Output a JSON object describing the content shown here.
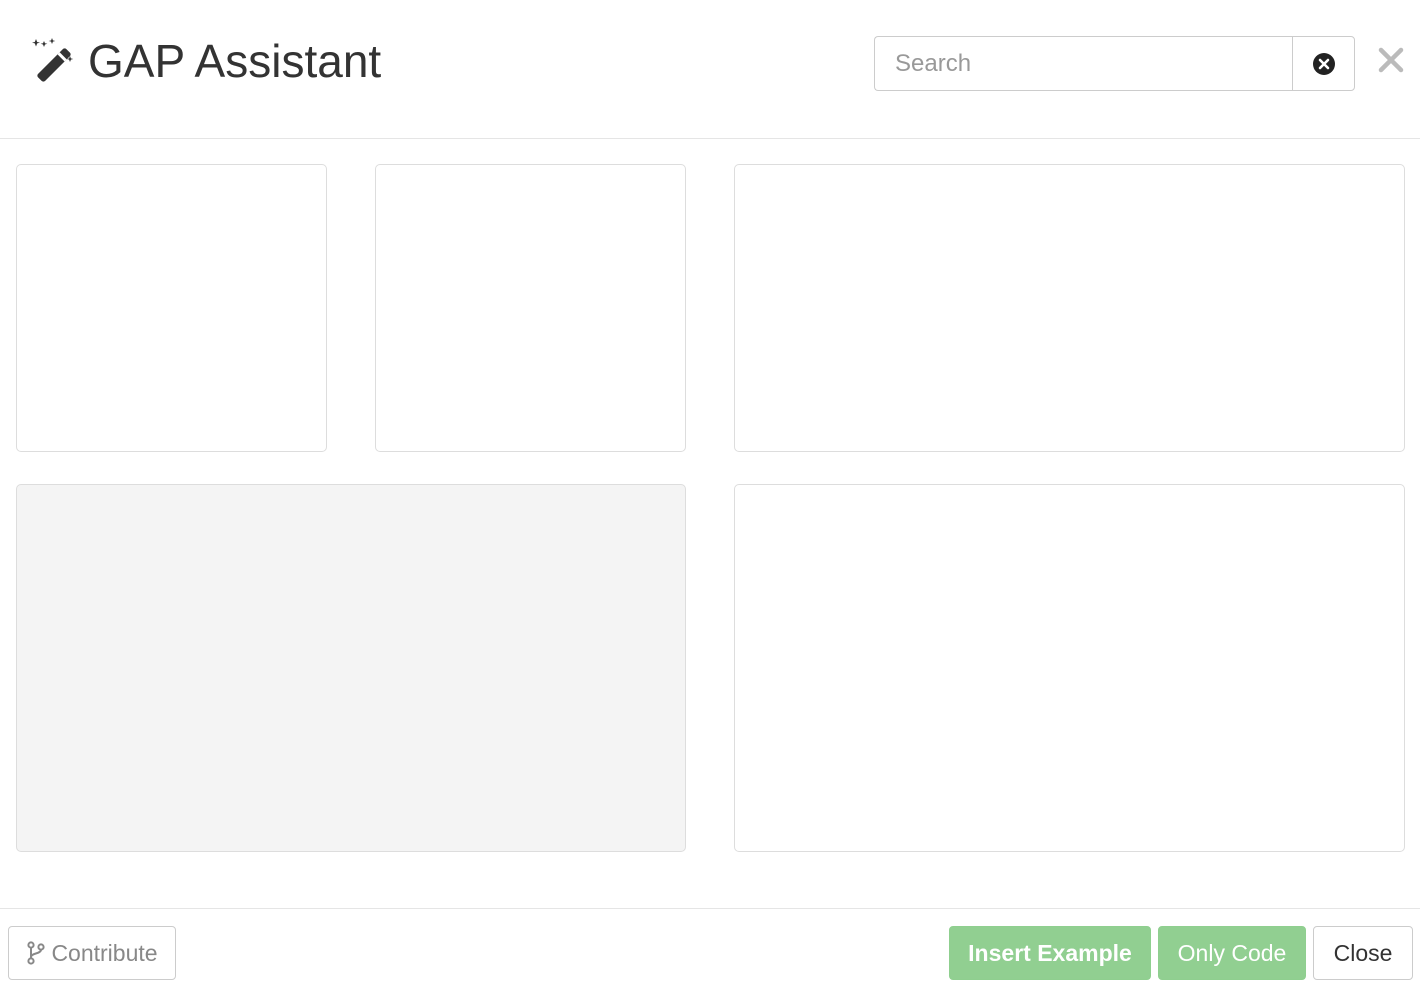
{
  "header": {
    "title": "GAP Assistant",
    "title_icon": "magic-wand-icon",
    "search": {
      "placeholder": "Search",
      "value": "",
      "clear_icon": "times-circle-icon"
    },
    "close_icon": "close-x-icon"
  },
  "footer": {
    "contribute_label": "Contribute",
    "contribute_icon": "code-fork-icon",
    "insert_example_label": "Insert Example",
    "only_code_label": "Only Code",
    "close_label": "Close"
  },
  "colors": {
    "accent_green": "#91cf91",
    "border": "#dddddd",
    "text": "#333333",
    "muted_text": "#888888",
    "gray_panel": "#f4f4f4"
  }
}
